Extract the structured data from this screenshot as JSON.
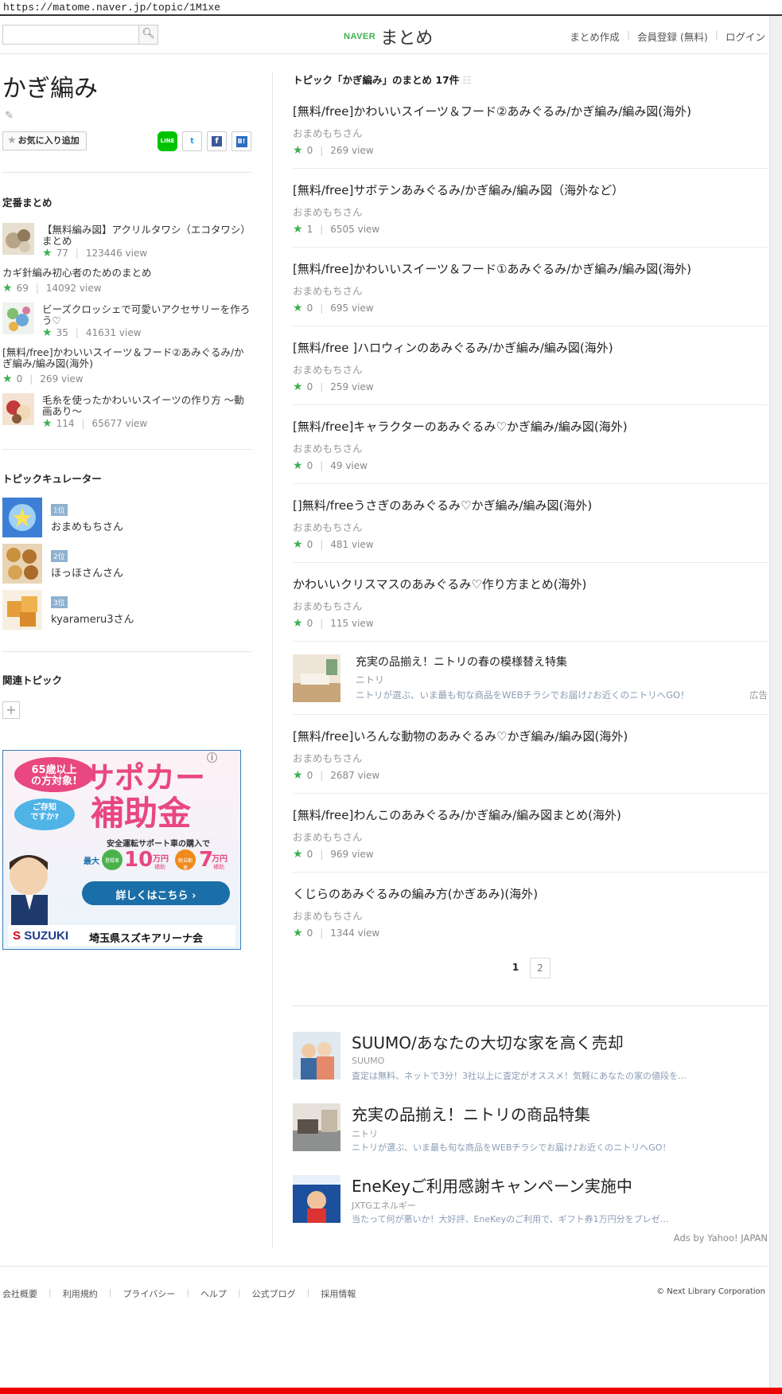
{
  "url": "https://matome.naver.jp/topic/1M1xe",
  "header": {
    "search_placeholder": "",
    "logo_naver": "NAVER",
    "logo_matome": "まとめ",
    "links": [
      "まとめ作成",
      "会員登録 (無料)",
      "ログイン"
    ]
  },
  "topic": {
    "title": "かぎ編み",
    "favorite_label": "お気に入り追加",
    "share": {
      "line": "LINE",
      "twitter": "t",
      "facebook": "f",
      "hatena": "B!"
    }
  },
  "standard": {
    "title": "定番まとめ",
    "items": [
      {
        "title": "【無料編み図】アクリルタワシ（エコタワシ）まとめ",
        "likes": "77",
        "views": "123446 view"
      },
      {
        "title": "カギ針編み初心者のためのまとめ",
        "likes": "69",
        "views": "14092 view"
      },
      {
        "title": "ビーズクロッシェで可愛いアクセサリーを作ろう♡",
        "likes": "35",
        "views": "41631 view"
      },
      {
        "title": "[無料/free]かわいいスイーツ＆フード②あみぐるみ/かぎ編み/編み図(海外)",
        "likes": "0",
        "views": "269 view"
      },
      {
        "title": "毛糸を使ったかわいいスイーツの作り方 〜動画あり〜",
        "likes": "114",
        "views": "65677 view"
      }
    ]
  },
  "curators": {
    "title": "トピックキュレーター",
    "items": [
      {
        "rank": "1位",
        "name": "おまめもちさん"
      },
      {
        "rank": "2位",
        "name": "ほっほさんさん"
      },
      {
        "rank": "3位",
        "name": "kyarameru3さん"
      }
    ]
  },
  "related": {
    "title": "関連トピック",
    "add": "+"
  },
  "banner": {
    "age": "65歳以上\nの方対象!",
    "question": "ご存知\nですか?",
    "headline1": "サポカー",
    "headline2": "補助金",
    "sub": "安全運転サポート車の購入で",
    "max": "最大",
    "amount1": "10",
    "amount2": "7",
    "unit": "万円",
    "unit_sub": "補助",
    "badge1": "登録車",
    "badge2": "軽自動車",
    "cta": "詳しくはこちら",
    "brand": "SUZUKI",
    "dealer": "埼玉県スズキアリーナ会"
  },
  "main": {
    "topic_count": "トピック「かぎ編み」のまとめ 17件",
    "articles": [
      {
        "title": "[無料/free]かわいいスイーツ＆フード②あみぐるみ/かぎ編み/編み図(海外)",
        "author": "おまめもちさん",
        "likes": "0",
        "views": "269 view"
      },
      {
        "title": "[無料/free]サボテンあみぐるみ/かぎ編み/編み図（海外など）",
        "author": "おまめもちさん",
        "likes": "1",
        "views": "6505 view"
      },
      {
        "title": "[無料/free]かわいいスイーツ＆フード①あみぐるみ/かぎ編み/編み図(海外)",
        "author": "おまめもちさん",
        "likes": "0",
        "views": "695 view"
      },
      {
        "title": "[無料/free ]ハロウィンのあみぐるみ/かぎ編み/編み図(海外)",
        "author": "おまめもちさん",
        "likes": "0",
        "views": "259 view"
      },
      {
        "title": "[無料/free]キャラクターのあみぐるみ♡かぎ編み/編み図(海外)",
        "author": "おまめもちさん",
        "likes": "0",
        "views": "49 view"
      },
      {
        "title": "[]無料/freeうさぎのあみぐるみ♡かぎ編み/編み図(海外)",
        "author": "おまめもちさん",
        "likes": "0",
        "views": "481 view"
      },
      {
        "title": "かわいいクリスマスのあみぐるみ♡作り方まとめ(海外)",
        "author": "おまめもちさん",
        "likes": "0",
        "views": "115 view"
      }
    ],
    "inline_ad": {
      "title": "充実の品揃え！ニトリの春の模様替え特集",
      "brand": "ニトリ",
      "desc": "ニトリが選ぶ、いま最も旬な商品をWEBチラシでお届け♪お近くのニトリへGO！",
      "pr": "広告"
    },
    "articles2": [
      {
        "title": "[無料/free]いろんな動物のあみぐるみ♡かぎ編み/編み図(海外)",
        "author": "おまめもちさん",
        "likes": "0",
        "views": "2687 view"
      },
      {
        "title": "[無料/free]わんこのあみぐるみ/かぎ編み/編み図まとめ(海外)",
        "author": "おまめもちさん",
        "likes": "0",
        "views": "969 view"
      },
      {
        "title": "くじらのあみぐるみの編み方(かぎあみ)(海外)",
        "author": "おまめもちさん",
        "likes": "0",
        "views": "1344 view"
      }
    ],
    "pages": [
      "1",
      "2"
    ],
    "ads": [
      {
        "title": "SUUMO/あなたの大切な家を高く売却",
        "brand": "SUUMO",
        "desc": "査定は無料、ネットで3分！3社以上に査定がオススメ！気軽にあなたの家の値段を…"
      },
      {
        "title": "充実の品揃え！ニトリの商品特集",
        "brand": "ニトリ",
        "desc": "ニトリが選ぶ、いま最も旬な商品をWEBチラシでお届け♪お近くのニトリへGO！"
      },
      {
        "title": "EneKeyご利用感謝キャンペーン実施中",
        "brand": "JXTGエネルギー",
        "desc": "当たって何が悪いか！大好評、EneKeyのご利用で、ギフト券1万円分をプレゼ…"
      }
    ],
    "ads_by": "Ads by Yahoo! JAPAN"
  },
  "footer": {
    "links": [
      "会社概要",
      "利用規約",
      "プライバシー",
      "ヘルプ",
      "公式ブログ",
      "採用情報"
    ],
    "copyright": "© Next Library Corporation"
  },
  "colors": {
    "accent_green": "#3cb050",
    "rank_badge": "#8eb1cf",
    "ad_desc": "#8a9bb5",
    "bottom_line": "#ee0000"
  }
}
